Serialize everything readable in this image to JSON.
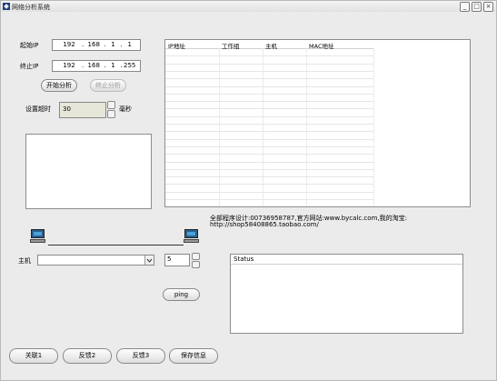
{
  "window": {
    "title": "网络分析系统"
  },
  "titlebar_buttons": {
    "minimize": "_",
    "maximize": "□",
    "close": "×"
  },
  "start_ip": {
    "label": "起始IP",
    "octets": [
      "192",
      "168",
      "1",
      "1"
    ]
  },
  "end_ip": {
    "label": "终止IP",
    "octets": [
      "192",
      "168",
      "1",
      "255"
    ]
  },
  "buttons": {
    "start": "开始分析",
    "stop": "终止分析",
    "ping": "ping",
    "bottom": [
      "关联1",
      "反馈2",
      "反馈3",
      "保存信息"
    ]
  },
  "timeout": {
    "label": "设置超时",
    "value": "30",
    "unit": "毫秒"
  },
  "table": {
    "columns": [
      "IP地址",
      "工作组",
      "主机",
      "MAC地址"
    ],
    "rows": []
  },
  "credits": {
    "line1": "全部程序设计:00736958787,官方网站:www.bycalc.com,我的淘宝:",
    "line2": "http://shop58408865.taobao.com/"
  },
  "host": {
    "label": "主机",
    "value": "",
    "count": "5"
  },
  "status": {
    "label": "Status"
  }
}
